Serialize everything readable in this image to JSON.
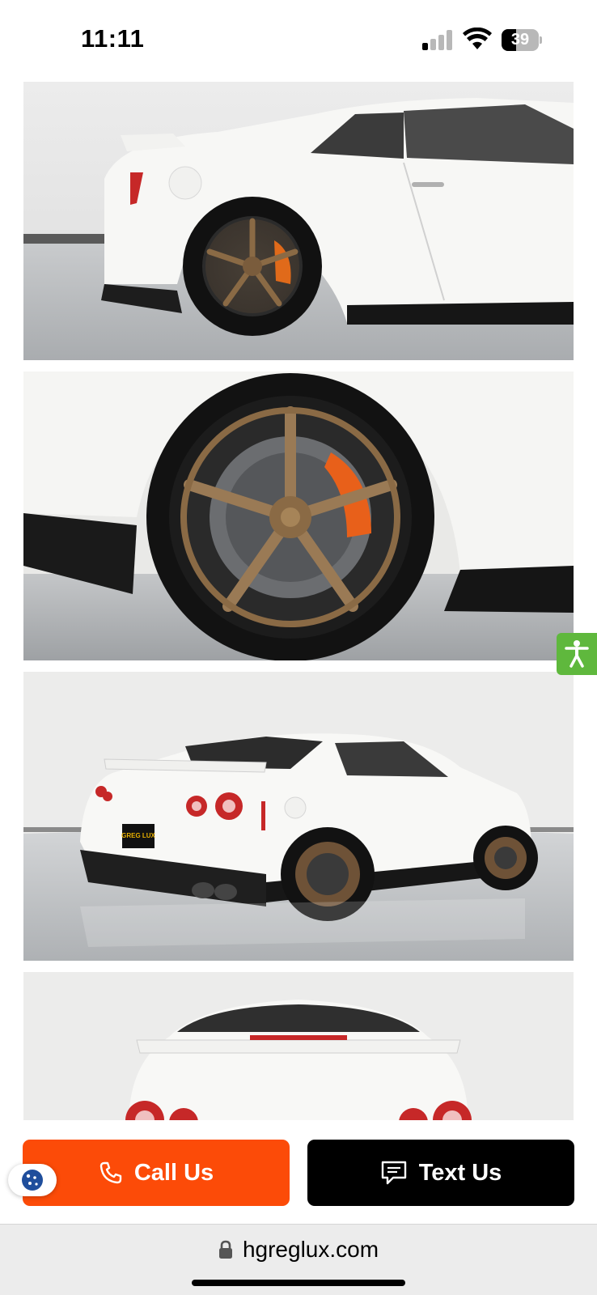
{
  "status_bar": {
    "time": "11:11",
    "battery": "39",
    "battery_level": 0.39,
    "signal_bars": 1
  },
  "gallery": {
    "photos": [
      {
        "subject": "side-rear-quarter-view"
      },
      {
        "subject": "rear-wheel-closeup"
      },
      {
        "subject": "rear-three-quarter-view"
      },
      {
        "subject": "rear-view"
      }
    ],
    "badge_text": "GREG LUX"
  },
  "accessibility": {
    "icon": "accessibility-icon",
    "color": "#5fb83d"
  },
  "actions": {
    "call_label": "Call Us",
    "call_icon": "phone-icon",
    "call_color": "#fc4b08",
    "text_label": "Text Us",
    "text_icon": "message-icon",
    "text_color": "#000000",
    "cookie_icon": "cookie-icon"
  },
  "browser": {
    "url": "hgreglux.com",
    "lock_icon": "lock-icon"
  }
}
